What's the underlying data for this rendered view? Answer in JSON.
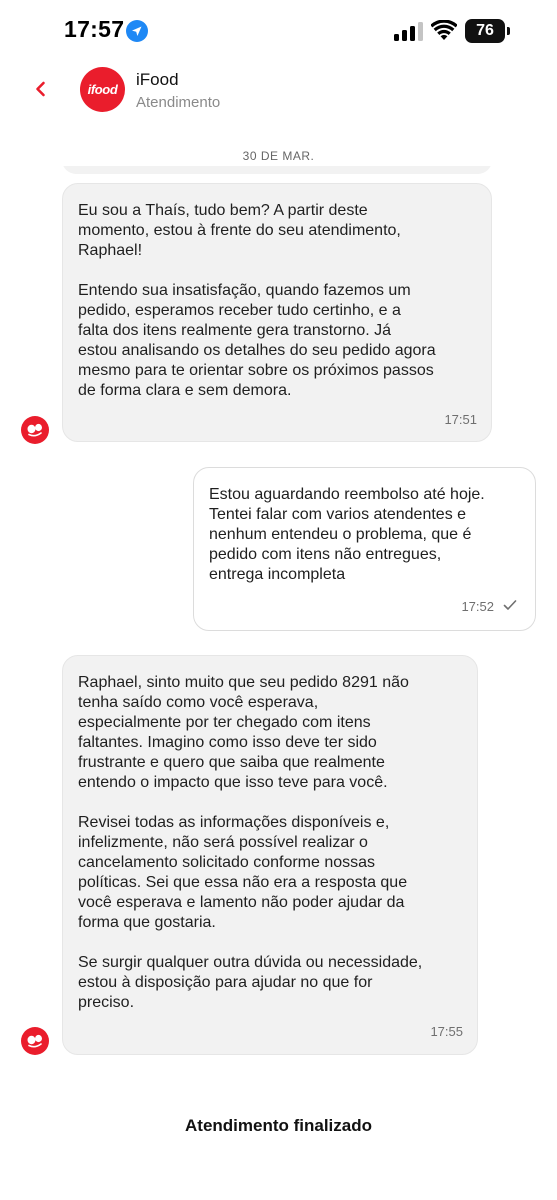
{
  "status_bar": {
    "time": "17:57",
    "battery": "76",
    "location_icon": "location-arrow-icon",
    "signal_icon": "cellular-signal-icon",
    "wifi_icon": "wifi-icon"
  },
  "header": {
    "back_icon": "chevron-left-icon",
    "logo_text": "ifood",
    "title": "iFood",
    "subtitle": "Atendimento"
  },
  "date_label": "30 DE MAR.",
  "messages": [
    {
      "direction": "incoming",
      "text": "Eu sou a Thaís, tudo bem? A partir deste\nmomento, estou à frente do seu atendimento,\nRaphael!\n\nEntendo sua insatisfação, quando fazemos um\npedido, esperamos receber tudo certinho, e a\nfalta dos itens realmente gera transtorno. Já\nestou analisando os detalhes do seu pedido agora\nmesmo para te orientar sobre os próximos passos\nde forma clara e sem demora.",
      "time": "17:51"
    },
    {
      "direction": "outgoing",
      "text": "Estou aguardando reembolso até hoje.\nTentei falar com varios atendentes e\nnenhum entendeu o problema, que é\npedido com itens não entregues,\nentrega incompleta",
      "time": "17:52",
      "status_icon": "checkmark-icon"
    },
    {
      "direction": "incoming",
      "text": "Raphael, sinto muito que seu pedido 8291 não\ntenha saído como você esperava,\nespecialmente por ter chegado com itens\nfaltantes. Imagino como isso deve ter sido\nfrustrante e quero que saiba que realmente\nentendo o impacto que isso teve para você.\n\nRevisei todas as informações disponíveis e,\ninfelizmente, não será possível realizar o\ncancelamento solicitado conforme nossas\npolíticas. Sei que essa não era a resposta que\nvocê esperava e lamento não poder ajudar da\nforma que gostaria.\n\nSe surgir qualquer outra dúvida ou necessidade,\nestou à disposição para ajudar no que for\npreciso.",
      "time": "17:55"
    }
  ],
  "footer": {
    "status": "Atendimento finalizado"
  },
  "colors": {
    "brand": "#ea1d2c",
    "incoming_bubble": "#f2f2f2",
    "outgoing_bubble": "#ffffff"
  }
}
